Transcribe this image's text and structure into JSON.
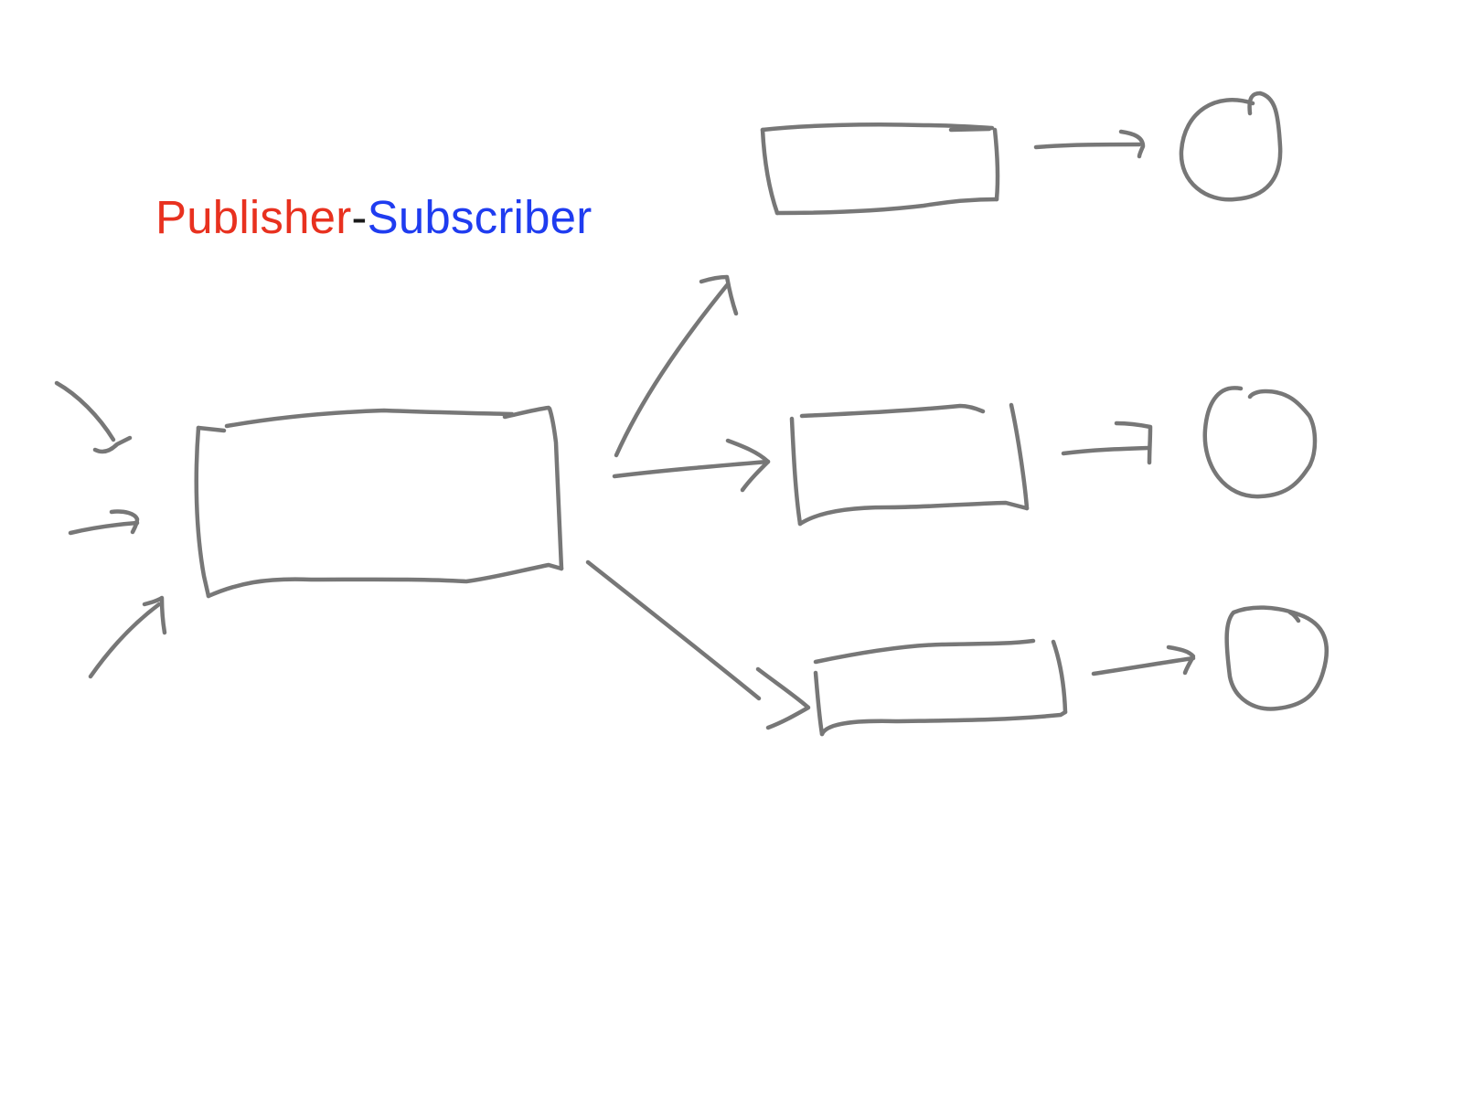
{
  "title": {
    "publisher": "Publisher",
    "separator": "-",
    "subscriber": "Subscriber"
  },
  "colors": {
    "publisher": "#e8311f",
    "separator": "#1a1a1a",
    "subscriber": "#1f3cf0",
    "stroke": "#777777"
  }
}
